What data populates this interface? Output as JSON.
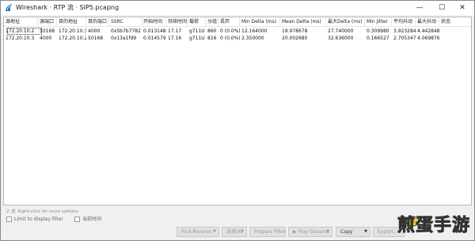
{
  "window": {
    "title": "Wireshark · RTP 流 · SIP5.pcapng",
    "controls": {
      "minimize": "—",
      "maximize": "☐",
      "close": "✕"
    }
  },
  "table": {
    "columns": [
      "源地址",
      "源端口",
      "目的地址",
      "目的端口",
      "SSRC",
      "开始时间",
      "持续时间",
      "载荷",
      "分组",
      "丢弃",
      "Min Delta (ms)",
      "Mean Delta (ms)",
      "最大Delta (ms)",
      "Min Jitter",
      "平均抖动",
      "最大抖动",
      "状态"
    ],
    "rows": [
      [
        "172.20.10.2",
        "50168",
        "172.20.10.3",
        "4000",
        "0x5b7b7782",
        "0.013148",
        "17.17",
        "g711U",
        "860",
        "0 (0.0%)",
        "12.164000",
        "19.978678",
        "27.740000",
        "0.309980",
        "3.923284",
        "4.442848",
        ""
      ],
      [
        "172.20.10.3",
        "4000",
        "172.20.10.2",
        "50168",
        "0x13a1fd9",
        "0.014579",
        "17.16",
        "g711U",
        "816",
        "0 (0.0%)",
        "2.350000",
        "20.002680",
        "32.636000",
        "0.166527",
        "2.705347",
        "4.069876",
        ""
      ]
    ],
    "selected": {
      "row": 0,
      "column": 0
    }
  },
  "hint": "2 流, Right-click for more options",
  "checks": [
    {
      "label": "Limit to display filter",
      "checked": false
    },
    {
      "label": "当前时间",
      "checked": false
    }
  ],
  "buttons": {
    "find_reverse": "Find Reverse",
    "select": "选择(A)",
    "prepare_filter": "Prepare Filter",
    "play_streams": "▶ Play Streams",
    "copy": "Copy",
    "export": "Export..."
  },
  "watermark": "煎蛋手游",
  "colors": {
    "accent_blue": "#1e6fbf",
    "disabled_text": "#9b9b9b"
  }
}
